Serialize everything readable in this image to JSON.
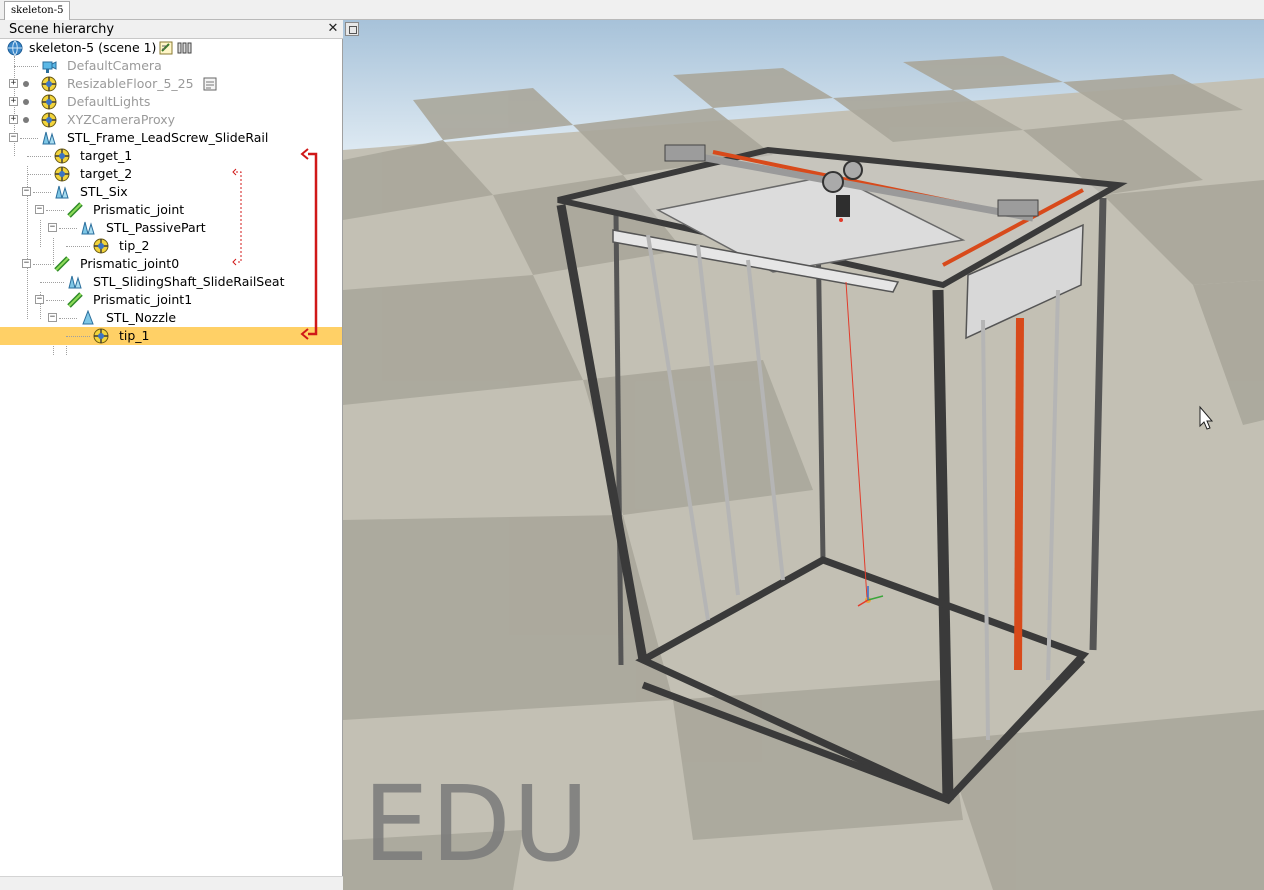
{
  "document_tab": {
    "label": "skeleton-5"
  },
  "scene_hierarchy": {
    "title": "Scene hierarchy",
    "close_glyph": "✕",
    "items": [
      {
        "label": "skeleton-5 (scene 1)",
        "icon": "globe-icon"
      },
      {
        "label": "DefaultCamera",
        "icon": "camera-icon",
        "dimmed": true
      },
      {
        "label": "ResizableFloor_5_25",
        "icon": "dummy-icon",
        "dimmed": true,
        "expander": "+"
      },
      {
        "label": "DefaultLights",
        "icon": "dummy-icon",
        "dimmed": true,
        "expander": "+"
      },
      {
        "label": "XYZCameraProxy",
        "icon": "dummy-icon",
        "dimmed": true,
        "expander": "+"
      },
      {
        "label": "STL_Frame_LeadScrew_SlideRail",
        "icon": "shape-icon",
        "expander": "−"
      },
      {
        "label": "target_1",
        "icon": "dummy-icon"
      },
      {
        "label": "target_2",
        "icon": "dummy-icon"
      },
      {
        "label": "STL_Six",
        "icon": "shape-icon",
        "expander": "−"
      },
      {
        "label": "Prismatic_joint",
        "icon": "prismatic-joint-icon",
        "expander": "−"
      },
      {
        "label": "STL_PassivePart",
        "icon": "shape-icon",
        "expander": "−"
      },
      {
        "label": "tip_2",
        "icon": "dummy-icon"
      },
      {
        "label": "Prismatic_joint0",
        "icon": "prismatic-joint-icon",
        "expander": "−"
      },
      {
        "label": "STL_SlidingShaft_SlideRailSeat",
        "icon": "shape-icon"
      },
      {
        "label": "Prismatic_joint1",
        "icon": "prismatic-joint-icon",
        "expander": "−"
      },
      {
        "label": "STL_Nozzle",
        "icon": "shape-icon",
        "expander": "−"
      },
      {
        "label": "tip_1",
        "icon": "dummy-icon",
        "selected": true
      }
    ]
  },
  "viewport": {
    "watermark": "EDU",
    "floor_colors": [
      "#d2cfc3",
      "#aaa79b"
    ],
    "sky_top": "#a7c2d9",
    "sky_bottom": "#dde9f2",
    "accent_red": "#d84a1b"
  }
}
